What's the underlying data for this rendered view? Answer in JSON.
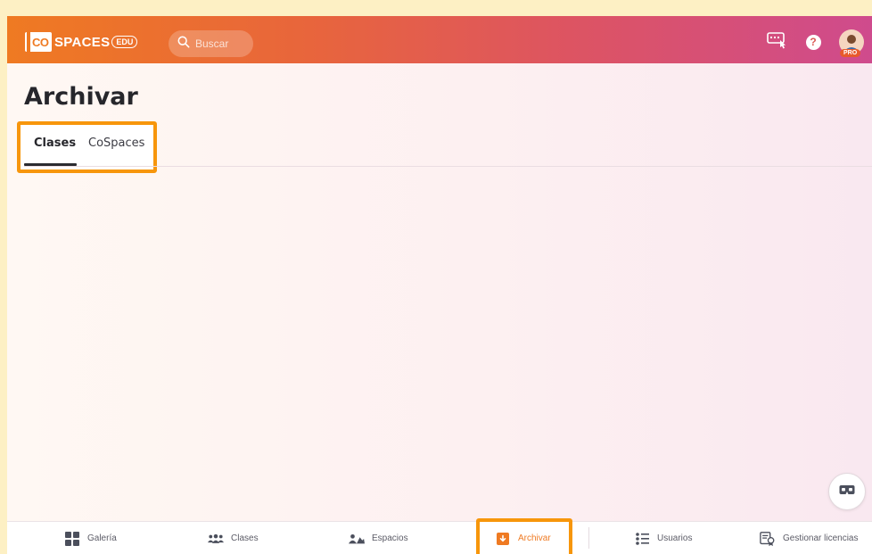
{
  "app": {
    "logo_co": "CO",
    "logo_text": "SPACES",
    "logo_edu": "EDU"
  },
  "search": {
    "placeholder": "Buscar"
  },
  "header": {
    "help": "?",
    "pro_badge": "PRO"
  },
  "page": {
    "title": "Archivar"
  },
  "tabs": [
    {
      "label": "Clases",
      "active": true
    },
    {
      "label": "CoSpaces",
      "active": false
    }
  ],
  "bottom_nav": [
    {
      "label": "Galería",
      "icon": "grid-icon"
    },
    {
      "label": "Clases",
      "icon": "group-icon"
    },
    {
      "label": "Espacios",
      "icon": "spaces-icon"
    },
    {
      "label": "Archivar",
      "icon": "archive-icon",
      "active": true
    },
    {
      "label": "Usuarios",
      "icon": "users-list-icon"
    },
    {
      "label": "Gestionar licencias",
      "icon": "license-icon"
    }
  ],
  "colors": {
    "accent": "#f7960b",
    "brand_orange": "#ef7a22",
    "brand_pink": "#cf4b8d"
  }
}
